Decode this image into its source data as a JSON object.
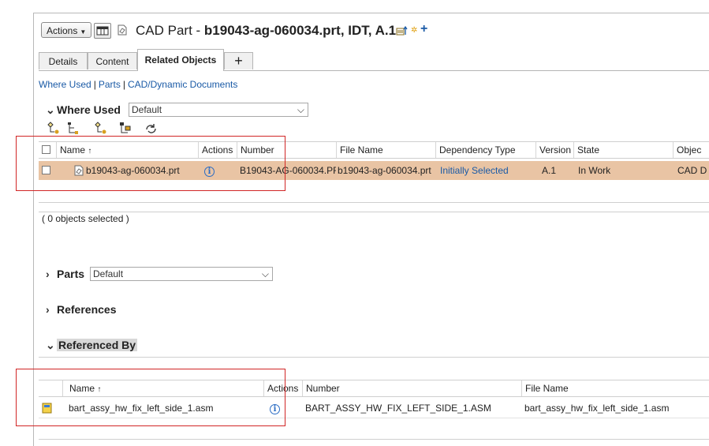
{
  "header": {
    "actions_label": "Actions",
    "title_prefix": "CAD Part - ",
    "title_bold": "b19043-ag-060034.prt, IDT, A.1"
  },
  "tabs": [
    {
      "label": "Details"
    },
    {
      "label": "Content"
    },
    {
      "label": "Related Objects"
    },
    {
      "label": "+"
    }
  ],
  "sublinks": [
    "Where Used",
    "Parts",
    "CAD/Dynamic Documents"
  ],
  "where_used": {
    "title": "Where Used",
    "view": "Default",
    "columns": [
      "Name",
      "Actions",
      "Number",
      "File Name",
      "Dependency Type",
      "Version",
      "State",
      "Objec"
    ],
    "rows": [
      {
        "name": "b19043-ag-060034.prt",
        "number": "B19043-AG-060034.PR",
        "file_name": "b19043-ag-060034.prt",
        "dependency_type": "Initially Selected",
        "version": "A.1",
        "state": "In Work",
        "object_type": "CAD D"
      }
    ],
    "selection_status": "( 0 objects selected )"
  },
  "parts": {
    "title": "Parts",
    "view": "Default"
  },
  "references": {
    "title": "References"
  },
  "referenced_by": {
    "title": "Referenced By",
    "columns": [
      "Name",
      "Actions",
      "Number",
      "File Name"
    ],
    "rows": [
      {
        "name": "bart_assy_hw_fix_left_side_1.asm",
        "number": "BART_ASSY_HW_FIX_LEFT_SIDE_1.ASM",
        "file_name": "bart_assy_hw_fix_left_side_1.asm"
      }
    ]
  },
  "colors": {
    "selected_row": "#e9c4a4",
    "link": "#1a5aa6",
    "highlight_box": "#d12626",
    "section_highlight": "#d8d8d8"
  }
}
